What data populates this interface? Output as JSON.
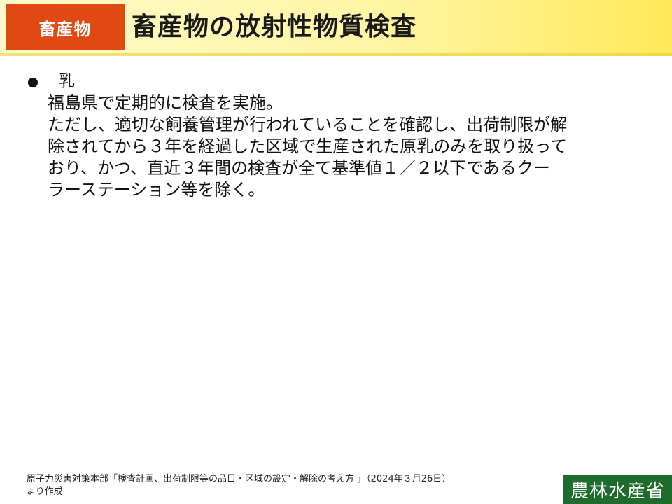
{
  "header": {
    "category_label": "畜産物",
    "title": "畜産物の放射性物質検査"
  },
  "content": {
    "bullet_heading": "乳",
    "lines": [
      "福島県で定期的に検査を実施。",
      "ただし、適切な飼養管理が行われていることを確認し、出荷制限が解",
      "除されてから３年を経過した区域で生産された原乳のみを取り扱って",
      "おり、かつ、直近３年間の検査が全て基準値１／２以下であるクー",
      "ラーステーション等を除く。"
    ]
  },
  "footer": {
    "source_line_1": "原子力災害対策本部「検査計画、出荷制限等の品目・区域の設定・解除の考え方 」（2024年３月26日）",
    "source_line_2": "より作成",
    "ministry": "農林水産省"
  },
  "colors": {
    "badge": "#e04a12",
    "header_start": "#fff9c9",
    "header_end": "#ffe95a",
    "ministry_green": "#1d6b2d"
  }
}
